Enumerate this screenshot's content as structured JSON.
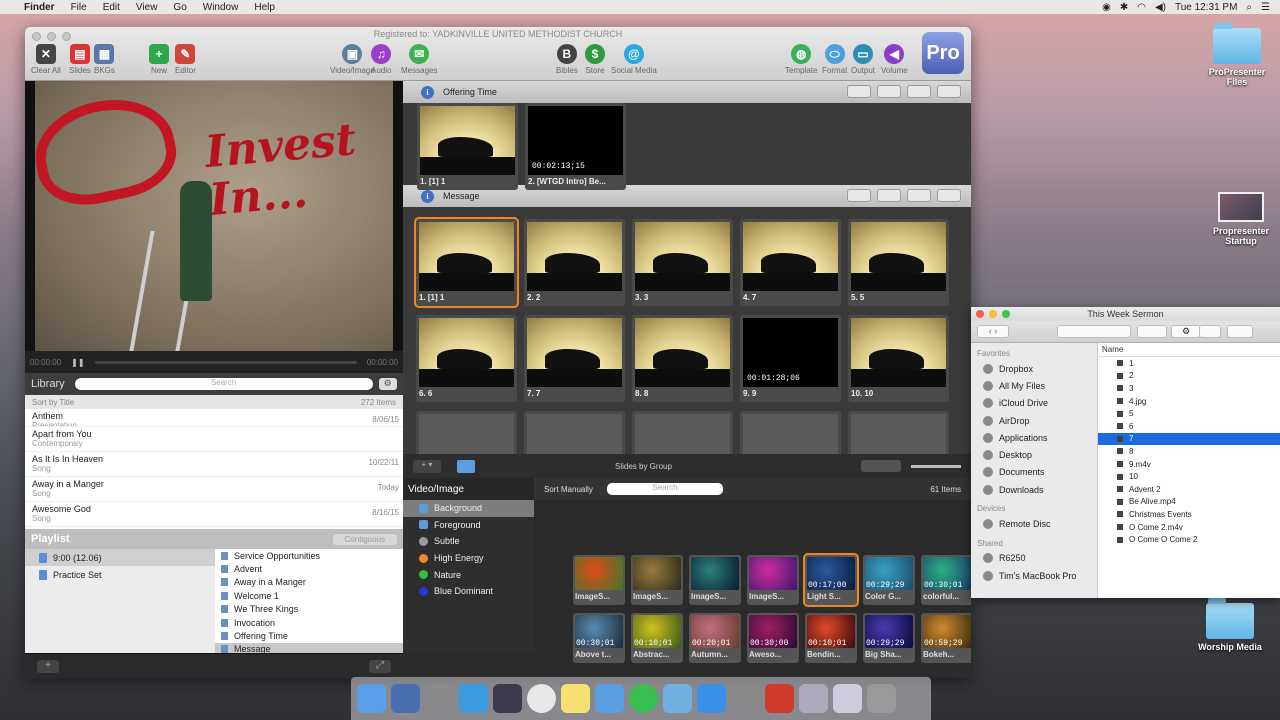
{
  "menubar": {
    "app": "Finder",
    "items": [
      "File",
      "Edit",
      "View",
      "Go",
      "Window",
      "Help"
    ],
    "clock": "Tue 12:31 PM"
  },
  "desktop": {
    "icons": [
      "ProPresenter Files",
      "Propresenter Startup",
      "Worship Media"
    ]
  },
  "window": {
    "registered": "Registered to: YADKINVILLE UNITED METHODIST CHURCH"
  },
  "toolbar": {
    "left": [
      {
        "label": "Clear All",
        "color": "#444",
        "glyph": "✕"
      },
      {
        "label": "Slides",
        "color": "#d33",
        "glyph": "▤"
      },
      {
        "label": "BKGs",
        "color": "#5577aa",
        "glyph": "▦"
      },
      {
        "label": "New",
        "color": "#2da84a",
        "glyph": "+"
      },
      {
        "label": "Editor",
        "color": "#d0473a",
        "glyph": "✎"
      }
    ],
    "mid": [
      {
        "label": "Video/Image",
        "color": "#5c7f95",
        "glyph": "▣"
      },
      {
        "label": "Audio",
        "color": "#9c3ec9",
        "glyph": "♫"
      },
      {
        "label": "Messages",
        "color": "#3cb24e",
        "glyph": "✉"
      }
    ],
    "store": [
      {
        "label": "Bibles",
        "color": "#444",
        "glyph": "B"
      },
      {
        "label": "Store",
        "color": "#2e9a3d",
        "glyph": "$"
      },
      {
        "label": "Social Media",
        "color": "#2aa8df",
        "glyph": "@"
      }
    ],
    "right": [
      {
        "label": "Template",
        "color": "#3ab25a",
        "glyph": "◍"
      },
      {
        "label": "Format",
        "color": "#4aa0e0",
        "glyph": "⬭"
      },
      {
        "label": "Output",
        "color": "#2b8fb3",
        "glyph": "▭"
      },
      {
        "label": "Volume",
        "color": "#8b3ec9",
        "glyph": "◀"
      }
    ],
    "pro": "Pro"
  },
  "preview": {
    "text": "Invest In...",
    "time_left": "00:00:00",
    "time_right": "00:00:00"
  },
  "library": {
    "title": "Library",
    "search": "Search",
    "sort": "Sort by Title",
    "count": "272 Items",
    "rows": [
      {
        "title": "Anthem",
        "sub": "Presentation",
        "date": "8/06/15"
      },
      {
        "title": "Apart from You",
        "sub": "Contemporary",
        "date": ""
      },
      {
        "title": "As It Is In Heaven",
        "sub": "Song",
        "date": "10/22/11"
      },
      {
        "title": "Away in a Manger",
        "sub": "Song",
        "date": "Today"
      },
      {
        "title": "Awesome God",
        "sub": "Song",
        "date": "8/16/15"
      }
    ]
  },
  "playlist": {
    "title": "Playlist",
    "button": "Contiguous",
    "items": [
      "9:00 (12.06)",
      "Practice Set"
    ],
    "docs": [
      "Service Opportunities",
      "Advent",
      "Away in a Manger",
      "Welcome 1",
      "We Three Kings",
      "Invocation",
      "Offering Time",
      "Message"
    ]
  },
  "groups": {
    "offering": "Offering Time",
    "message": "Message"
  },
  "offering_slides": [
    {
      "cap": "1. [1] 1",
      "type": "camel",
      "tc": ""
    },
    {
      "cap": "2. [WTGD Intro] Be...",
      "type": "black",
      "tc": "00:02:13;15"
    }
  ],
  "message_slides": [
    {
      "cap": "1. [1] 1",
      "type": "camel",
      "tc": ""
    },
    {
      "cap": "2. 2",
      "type": "camel",
      "tc": ""
    },
    {
      "cap": "3. 3",
      "type": "camel",
      "tc": ""
    },
    {
      "cap": "4. 7",
      "type": "camel",
      "tc": ""
    },
    {
      "cap": "5. 5",
      "type": "camel",
      "tc": ""
    },
    {
      "cap": "6. 6",
      "type": "camel",
      "tc": ""
    },
    {
      "cap": "7. 7",
      "type": "camel",
      "tc": ""
    },
    {
      "cap": "8. 8",
      "type": "camel",
      "tc": ""
    },
    {
      "cap": "9. 9",
      "type": "black",
      "tc": "00:01:28;06"
    },
    {
      "cap": "10. 10",
      "type": "camel",
      "tc": ""
    },
    {
      "cap": "",
      "type": "ghost",
      "tc": ""
    },
    {
      "cap": "",
      "type": "ghost",
      "tc": ""
    },
    {
      "cap": "",
      "type": "ghost",
      "tc": ""
    },
    {
      "cap": "",
      "type": "ghost",
      "tc": ""
    },
    {
      "cap": "",
      "type": "ghost",
      "tc": ""
    }
  ],
  "slidebar": {
    "label": "Slides by Group"
  },
  "media": {
    "title": "Video/Image",
    "sort": "Sort Manually",
    "search": "Search",
    "count": "61 Items",
    "categories": [
      {
        "name": "Background",
        "color": "#5a9bd8"
      },
      {
        "name": "Foreground",
        "color": "#5a9bd8"
      },
      {
        "name": "Subtle",
        "color": "#9a9a9a"
      },
      {
        "name": "High Energy",
        "color": "#f08a24"
      },
      {
        "name": "Nature",
        "color": "#2fc13a"
      },
      {
        "name": "Blue Dominant",
        "color": "#2337d6"
      }
    ],
    "thumbs": [
      {
        "cap": "ImageS...",
        "tc": "",
        "c1": "#e04a1a",
        "c2": "#3b7a2a"
      },
      {
        "cap": "ImageS...",
        "tc": "",
        "c1": "#9a7a40",
        "c2": "#2a2a1a"
      },
      {
        "cap": "ImageS...",
        "tc": "",
        "c1": "#2a8080",
        "c2": "#0a1a2a"
      },
      {
        "cap": "ImageS...",
        "tc": "",
        "c1": "#d02aa0",
        "c2": "#3a1a6a"
      },
      {
        "cap": "Light S...",
        "tc": "00:17;00",
        "c1": "#2a5aa0",
        "c2": "#0a1a3a"
      },
      {
        "cap": "Color G...",
        "tc": "00:29;29",
        "c1": "#3aa0c0",
        "c2": "#1a4a6a"
      },
      {
        "cap": "colorful...",
        "tc": "00:30;01",
        "c1": "#2ab080",
        "c2": "#1a3a6a"
      },
      {
        "cap": "Above t...",
        "tc": "00:30;01",
        "c1": "#5a8ab0",
        "c2": "#1a2a3a"
      },
      {
        "cap": "Abstrac...",
        "tc": "00:10;01",
        "c1": "#d0c020",
        "c2": "#3a5a1a"
      },
      {
        "cap": "Autumn...",
        "tc": "00:20;01",
        "c1": "#c07080",
        "c2": "#6a3a2a"
      },
      {
        "cap": "Aweso...",
        "tc": "00:30;00",
        "c1": "#a02060",
        "c2": "#2a0a3a"
      },
      {
        "cap": "Bendin...",
        "tc": "00:10;01",
        "c1": "#e04a2a",
        "c2": "#3a0a0a"
      },
      {
        "cap": "Big Sha...",
        "tc": "00:29;29",
        "c1": "#4a3ab0",
        "c2": "#0a0a3a"
      },
      {
        "cap": "Bokeh...",
        "tc": "00:59;29",
        "c1": "#d08a30",
        "c2": "#3a2a0a"
      }
    ]
  },
  "finder": {
    "title": "This Week Sermon",
    "favorites_label": "Favorites",
    "favorites": [
      "Dropbox",
      "All My Files",
      "iCloud Drive",
      "AirDrop",
      "Applications",
      "Desktop",
      "Documents",
      "Downloads"
    ],
    "devices_label": "Devices",
    "devices": [
      "Remote Disc"
    ],
    "shared_label": "Shared",
    "shared": [
      "R6250",
      "Tim's MacBook Pro"
    ],
    "column": "Name",
    "files": [
      "1",
      "2",
      "3",
      "4.jpg",
      "5",
      "6",
      "7",
      "8",
      "9.m4v",
      "10",
      "Advent 2",
      "Be Alive.mp4",
      "Christmas Events",
      "O Come 2.m4v",
      "O Come O Come 2"
    ],
    "selected": "7"
  },
  "dock": [
    "#5aa0e8",
    "#4a6fb0",
    "#8a8a8a",
    "#3a9ae0",
    "#3a3a4a",
    "#e8e8e8",
    "#f5e070",
    "#5aa0e0",
    "#3ac050",
    "#6fb0e0",
    "#3a90e8",
    "#888",
    "#d03a2a",
    "#aab",
    "#ccd",
    "#999"
  ]
}
